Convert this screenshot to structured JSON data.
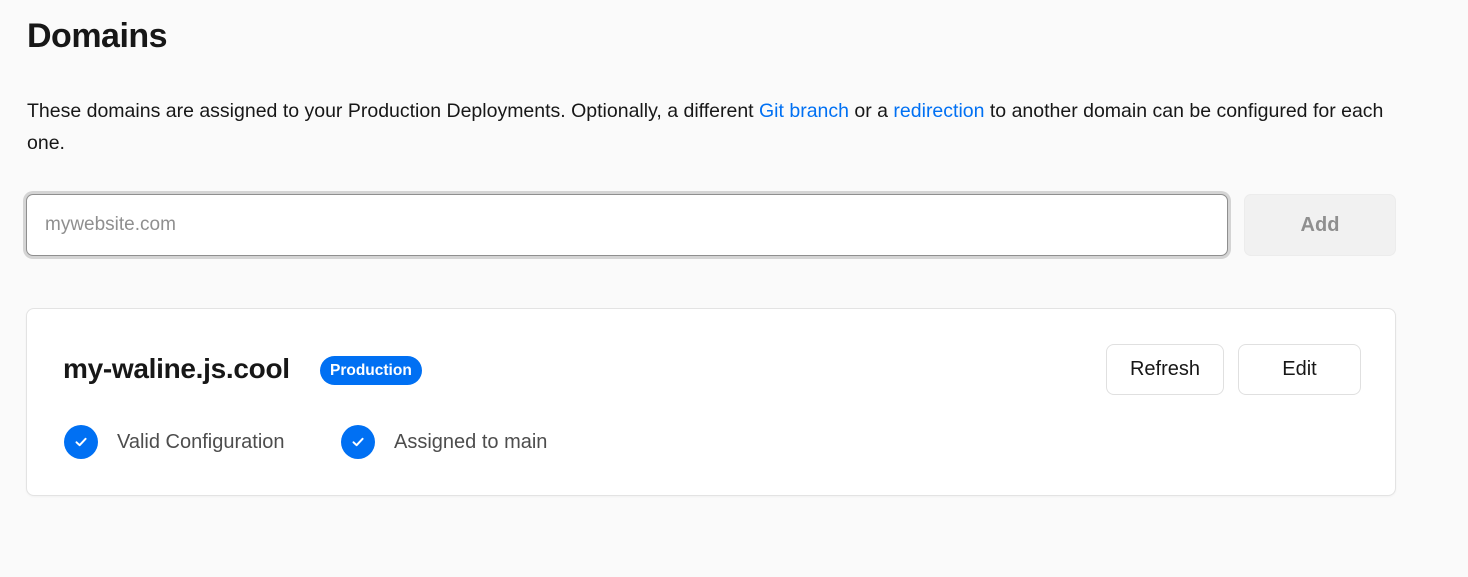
{
  "header": {
    "title": "Domains"
  },
  "description": {
    "text_1": "These domains are assigned to your Production Deployments. Optionally, a different ",
    "link_git_branch": "Git branch",
    "text_2": " or a ",
    "link_redirection": "redirection",
    "text_3": " to another domain can be configured for each one."
  },
  "add_domain": {
    "input_value": "",
    "placeholder": "mywebsite.com",
    "button_label": "Add"
  },
  "domain_card": {
    "domain": "my-waline.js.cool",
    "badge": "Production",
    "refresh_label": "Refresh",
    "edit_label": "Edit",
    "statuses": [
      {
        "label": "Valid Configuration",
        "icon": "check-icon"
      },
      {
        "label": "Assigned to main",
        "icon": "check-icon"
      }
    ]
  },
  "colors": {
    "accent": "#0070f3",
    "background": "#fafafa",
    "card": "#ffffff",
    "muted_text": "#4d4d4d"
  }
}
